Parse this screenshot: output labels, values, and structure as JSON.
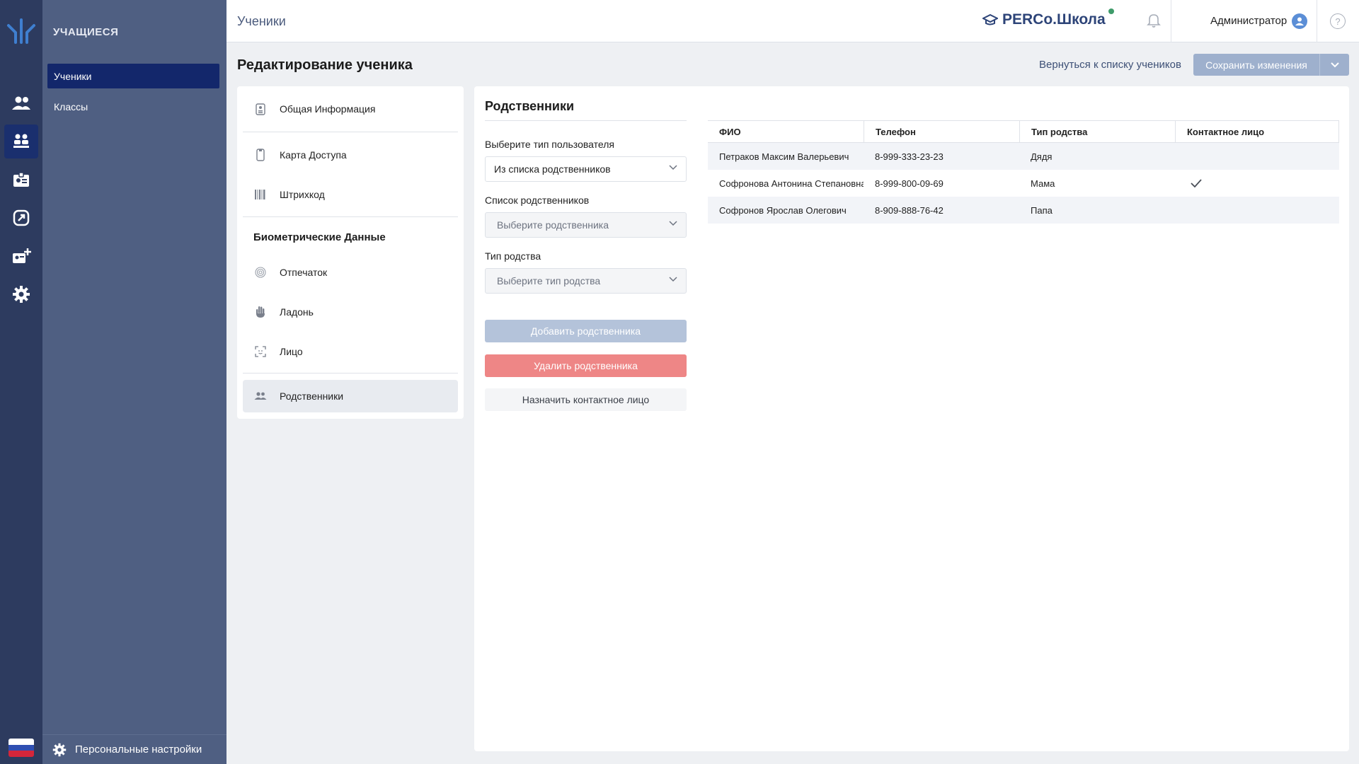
{
  "topbar": {
    "title": "Ученики",
    "brand": "PERCo.Школа",
    "user": "Администратор",
    "help": "?"
  },
  "sidebar": {
    "section_title": "УЧАЩИЕСЯ",
    "items": [
      {
        "label": "Ученики",
        "active": true
      },
      {
        "label": "Классы",
        "active": false
      }
    ],
    "footer": "Персональные настройки"
  },
  "rail": {
    "icons": [
      "users-icon",
      "students-icon",
      "id-card-icon",
      "link-icon",
      "add-card-icon",
      "settings-icon"
    ]
  },
  "page": {
    "title": "Редактирование ученика",
    "back_link": "Вернуться к списку учеников",
    "save_label": "Сохранить изменения"
  },
  "left_menu": {
    "general": "Общая Информация",
    "access_card": "Карта Доступа",
    "barcode": "Штрихкод",
    "biometric_heading": "Биометрические Данные",
    "fingerprint": "Отпечаток",
    "palm": "Ладонь",
    "face": "Лицо",
    "relatives": "Родственники"
  },
  "relatives": {
    "title": "Родственники",
    "user_type_label": "Выберите тип пользователя",
    "user_type_value": "Из списка родственников",
    "list_label": "Список родственников",
    "list_placeholder": "Выберите родственника",
    "kinship_label": "Тип родства",
    "kinship_placeholder": "Выберите тип родства",
    "add_button": "Добавить родственника",
    "delete_button": "Удалить родственника",
    "contact_button": "Назначить контактное лицо"
  },
  "table": {
    "headers": [
      "ФИО",
      "Телефон",
      "Тип родства",
      "Контактное лицо"
    ],
    "rows": [
      {
        "name": "Петраков Максим Валерьевич",
        "phone": "8-999-333-23-23",
        "kinship": "Дядя",
        "contact": false
      },
      {
        "name": "Софронова Антонина Степановна",
        "phone": "8-999-800-09-69",
        "kinship": "Мама",
        "contact": true
      },
      {
        "name": "Софронов Ярослав Олегович",
        "phone": "8-909-888-76-42",
        "kinship": "Папа",
        "contact": false
      }
    ]
  },
  "colors": {
    "rail": "#2d3b5f",
    "sidebar": "#4f5f82",
    "active_nav": "#13276b",
    "delete": "#ee8686",
    "add": "#b4c3da"
  }
}
